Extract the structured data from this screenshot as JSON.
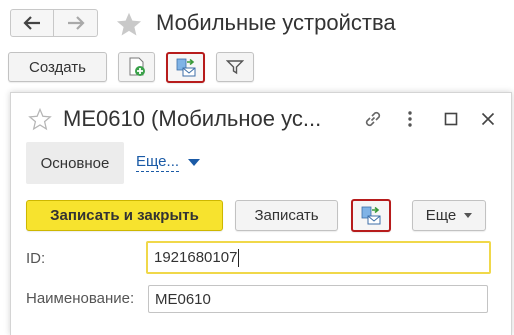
{
  "nav": {
    "back_icon": "arrow-left-icon",
    "forward_icon": "arrow-right-icon",
    "favorite_icon": "star-icon"
  },
  "page": {
    "title": "Мобильные устройства"
  },
  "toolbar": {
    "create_label": "Создать",
    "add_icon": "document-add-icon",
    "exchange_icon": "exchange-mail-icon",
    "filter_icon": "filter-icon"
  },
  "dialog": {
    "title": "МЕ0610 (Мобильное ус...",
    "tabs": {
      "main_label": "Основное",
      "more_label": "Еще..."
    },
    "actions": {
      "save_close_label": "Записать и закрыть",
      "save_label": "Записать",
      "more_label": "Еще"
    },
    "fields": {
      "id_label": "ID:",
      "id_value": "1921680107",
      "name_label": "Наименование:",
      "name_value": "МЕ0610"
    }
  },
  "colors": {
    "primary": "#f7e32e",
    "highlight_border": "#b71c1c",
    "focus": "#f0d84a",
    "link": "#1a5aa6"
  }
}
